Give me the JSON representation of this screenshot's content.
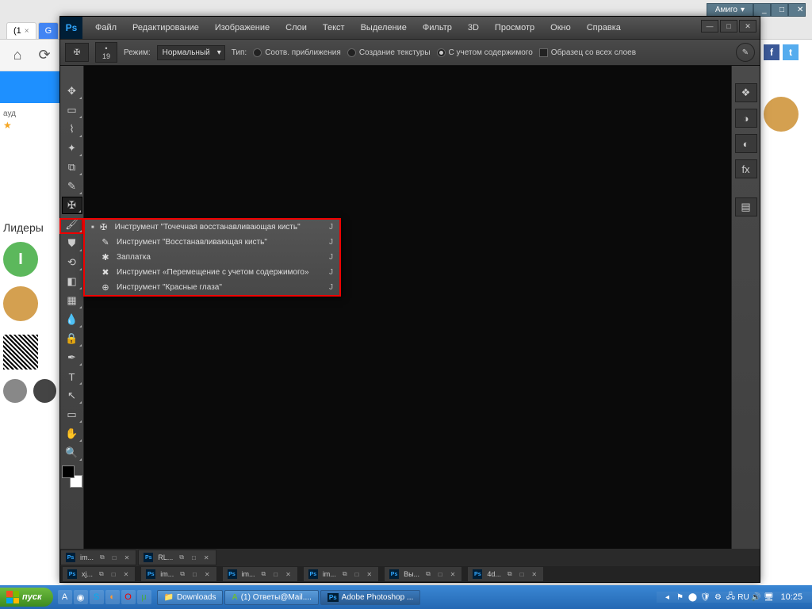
{
  "amigo": {
    "label": "Амиго",
    "min": "_",
    "max": "□",
    "close": "✕"
  },
  "browser": {
    "tab1": "(1",
    "gtab": "G"
  },
  "web_left": {
    "heading": "Лидеры",
    "text_aud": "ауд",
    "avatar_letter": "I"
  },
  "ps": {
    "logo": "Ps",
    "menu": [
      "Файл",
      "Редактирование",
      "Изображение",
      "Слои",
      "Текст",
      "Выделение",
      "Фильтр",
      "3D",
      "Просмотр",
      "Окно",
      "Справка"
    ],
    "win": {
      "min": "—",
      "max": "□",
      "close": "✕"
    },
    "options": {
      "size_dot": "•",
      "size_val": "19",
      "mode_label": "Режим:",
      "mode_value": "Нормальный",
      "type_label": "Тип:",
      "r1": "Соотв. приближения",
      "r2": "Создание текстуры",
      "r3": "С учетом содержимого",
      "cb": "Образец со всех слоев"
    },
    "flyout": [
      {
        "icon": "✠",
        "label": "Инструмент \"Точечная восстанавливающая кисть\"",
        "key": "J",
        "sel": true
      },
      {
        "icon": "✎",
        "label": "Инструмент \"Восстанавливающая кисть\"",
        "key": "J",
        "sel": false
      },
      {
        "icon": "✱",
        "label": "Заплатка",
        "key": "J",
        "sel": false
      },
      {
        "icon": "✖",
        "label": "Инструмент «Перемещение с учетом содержимого»",
        "key": "J",
        "sel": false
      },
      {
        "icon": "⊕",
        "label": "Инструмент \"Красные глаза\"",
        "key": "J",
        "sel": false
      }
    ],
    "doctabs_top": [
      {
        "name": "im..."
      },
      {
        "name": "RL..."
      }
    ],
    "doctabs_bot": [
      {
        "name": "xj..."
      },
      {
        "name": "im..."
      },
      {
        "name": "im..."
      },
      {
        "name": "im..."
      },
      {
        "name": "Вы..."
      },
      {
        "name": "4d..."
      }
    ]
  },
  "taskbar": {
    "start": "пуск",
    "tasks": [
      {
        "icon": "📁",
        "label": "Downloads"
      },
      {
        "icon": "А",
        "label": "(1) Ответы@Mail...."
      },
      {
        "icon": "Ps",
        "label": "Adobe Photoshop ..."
      }
    ],
    "clock": "10:25"
  }
}
